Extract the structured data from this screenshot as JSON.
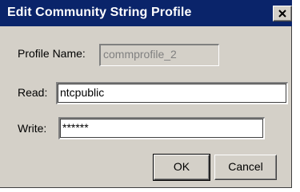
{
  "window": {
    "title": "Edit Community String Profile",
    "close_glyph": "✕"
  },
  "form": {
    "profile_name": {
      "label": "Profile Name:",
      "value": "commprofile_2"
    },
    "read": {
      "label": "Read:",
      "value": "ntcpublic"
    },
    "write": {
      "label": "Write:",
      "value": "******"
    }
  },
  "buttons": {
    "ok": "OK",
    "cancel": "Cancel"
  },
  "colors": {
    "titlebar": "#0a246a",
    "dialog_bg": "#d4d0c8"
  }
}
